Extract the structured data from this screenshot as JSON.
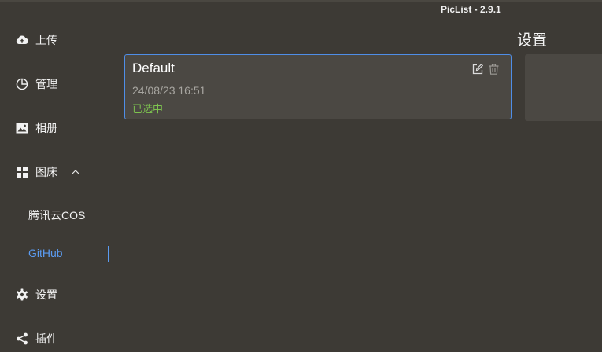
{
  "window": {
    "title": "PicList - 2.9.1"
  },
  "sidebar": {
    "items": [
      {
        "label": "上传",
        "icon": "cloud-upload-icon"
      },
      {
        "label": "管理",
        "icon": "pie-chart-icon"
      },
      {
        "label": "相册",
        "icon": "image-icon"
      },
      {
        "label": "图床",
        "icon": "grid-icon",
        "expanded": true
      },
      {
        "label": "设置",
        "icon": "gear-icon"
      },
      {
        "label": "插件",
        "icon": "share-icon"
      }
    ],
    "sub_items": [
      {
        "label": "腾讯云COS",
        "active": false
      },
      {
        "label": "GitHub",
        "active": true
      }
    ]
  },
  "main": {
    "config_card": {
      "name": "Default",
      "date": "24/08/23 16:51",
      "status": "已选中",
      "selected": true
    },
    "settings_title": "设置"
  },
  "colors": {
    "background": "#3d3a35",
    "card_background": "#4b4843",
    "accent": "#5b9bf0",
    "status_green": "#7dc34f"
  }
}
